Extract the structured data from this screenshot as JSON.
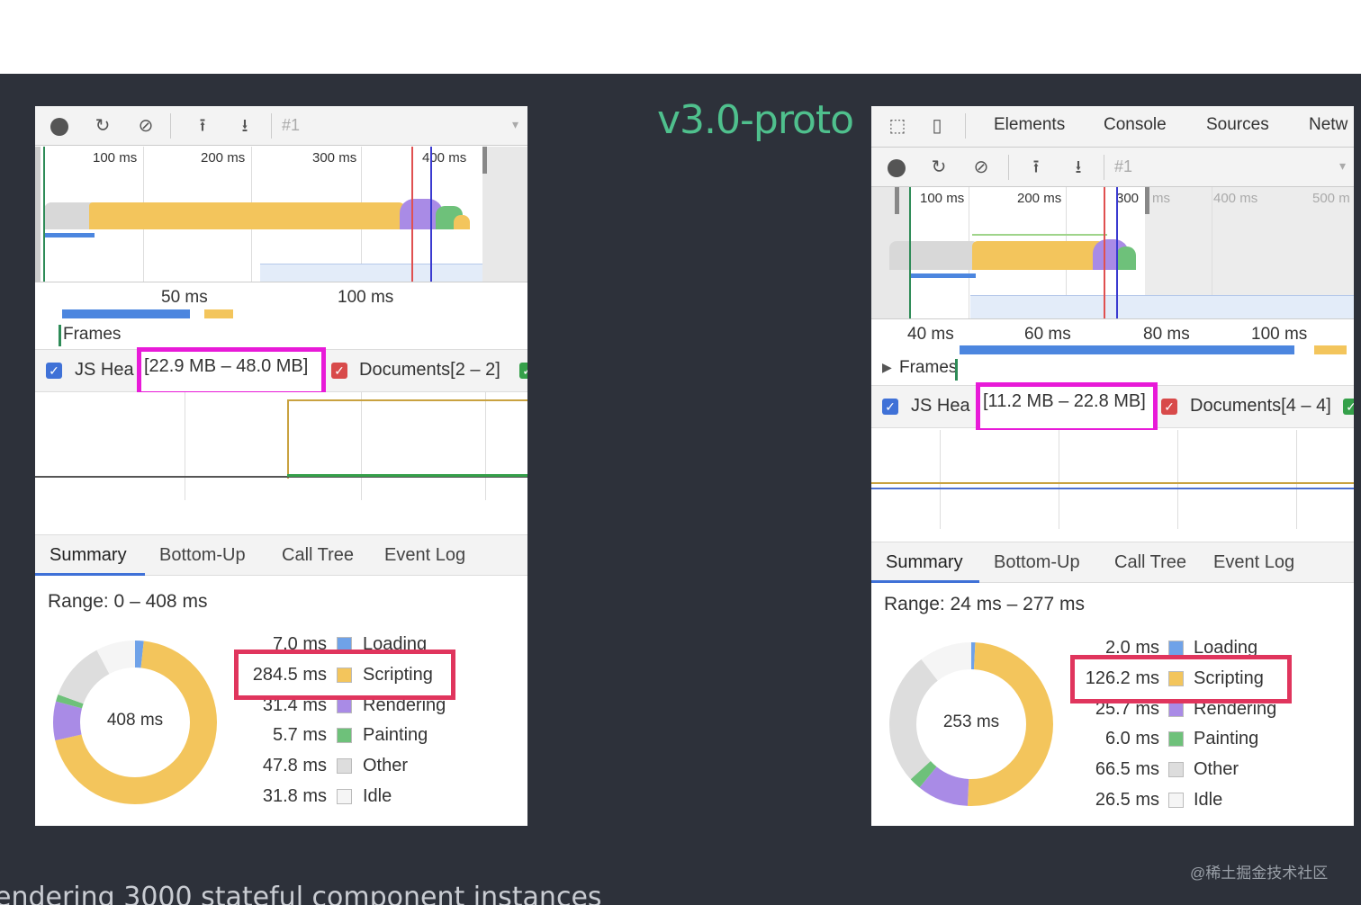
{
  "slide": {
    "title": "v3.0-proto",
    "caption": "endering 3000 stateful component instances",
    "watermark": "@稀土掘金技术社区"
  },
  "colors": {
    "background": "#2d313a",
    "title": "#4fc08d",
    "highlight": "#e81ad8",
    "selection_box": "#e0355d",
    "loading": "#6fa2e8",
    "scripting": "#f3c55c",
    "rendering": "#a98be6",
    "painting": "#6ec17a",
    "other": "#dddddd",
    "idle": "#f5f5f5"
  },
  "left": {
    "toolbar": {
      "record_icon": "record-icon",
      "reload_icon": "reload-icon",
      "clear_icon": "clear-icon",
      "upload_icon": "upload-icon",
      "download_icon": "download-icon",
      "profile_label": "#1",
      "caret": "▾"
    },
    "overview_ticks": [
      "100 ms",
      "200 ms",
      "300 ms",
      "400 ms"
    ],
    "ruler_ticks": [
      "50 ms",
      "100 ms"
    ],
    "frames_label": "Frames",
    "legend": {
      "js_heap_label": "JS Hea",
      "js_heap_range": "[22.9 MB – 48.0 MB]",
      "documents_label": "Documents[2 – 2]"
    },
    "tabs": [
      "Summary",
      "Bottom-Up",
      "Call Tree",
      "Event Log"
    ],
    "active_tab": "Summary",
    "range": "Range: 0 – 408 ms",
    "total": "408 ms",
    "categories": [
      {
        "value": "7.0 ms",
        "name": "Loading",
        "color": "#6fa2e8",
        "ms": 7.0
      },
      {
        "value": "284.5 ms",
        "name": "Scripting",
        "color": "#f3c55c",
        "ms": 284.5
      },
      {
        "value": "31.4 ms",
        "name": "Rendering",
        "color": "#a98be6",
        "ms": 31.4
      },
      {
        "value": "5.7 ms",
        "name": "Painting",
        "color": "#6ec17a",
        "ms": 5.7
      },
      {
        "value": "47.8 ms",
        "name": "Other",
        "color": "#dddddd",
        "ms": 47.8
      },
      {
        "value": "31.8 ms",
        "name": "Idle",
        "color": "#f5f5f5",
        "ms": 31.8
      }
    ]
  },
  "right": {
    "top_tabs": [
      "Elements",
      "Console",
      "Sources",
      "Netw"
    ],
    "toolbar": {
      "inspect_icon": "inspect-icon",
      "device_icon": "device-icon",
      "record_icon": "record-icon",
      "reload_icon": "reload-icon",
      "clear_icon": "clear-icon",
      "upload_icon": "upload-icon",
      "download_icon": "download-icon",
      "profile_label": "#1",
      "caret": "▾"
    },
    "overview_ticks": [
      "100 ms",
      "200 ms",
      "300",
      "ms",
      "400 ms",
      "500 m"
    ],
    "ruler_ticks": [
      "40 ms",
      "60 ms",
      "80 ms",
      "100 ms"
    ],
    "frames_label": "Frames",
    "legend": {
      "js_heap_label": "JS Hea",
      "js_heap_range": "[11.2 MB – 22.8 MB]",
      "documents_label": "Documents[4 – 4]"
    },
    "tabs": [
      "Summary",
      "Bottom-Up",
      "Call Tree",
      "Event Log"
    ],
    "active_tab": "Summary",
    "range": "Range: 24 ms – 277 ms",
    "total": "253 ms",
    "categories": [
      {
        "value": "2.0 ms",
        "name": "Loading",
        "color": "#6fa2e8",
        "ms": 2.0
      },
      {
        "value": "126.2 ms",
        "name": "Scripting",
        "color": "#f3c55c",
        "ms": 126.2
      },
      {
        "value": "25.7 ms",
        "name": "Rendering",
        "color": "#a98be6",
        "ms": 25.7
      },
      {
        "value": "6.0 ms",
        "name": "Painting",
        "color": "#6ec17a",
        "ms": 6.0
      },
      {
        "value": "66.5 ms",
        "name": "Other",
        "color": "#dddddd",
        "ms": 66.5
      },
      {
        "value": "26.5 ms",
        "name": "Idle",
        "color": "#f5f5f5",
        "ms": 26.5
      }
    ]
  }
}
